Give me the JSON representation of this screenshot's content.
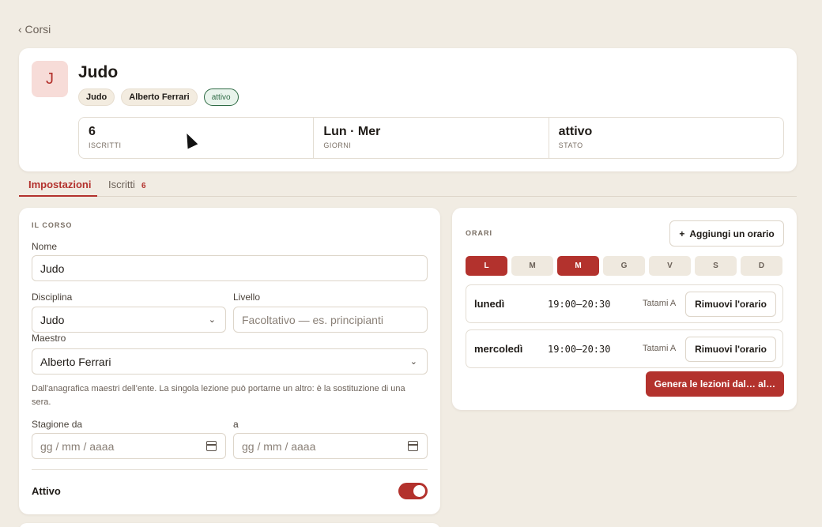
{
  "nav": {
    "back_label": "‹ Corsi"
  },
  "course": {
    "initial": "J",
    "title": "Judo",
    "chips": [
      "Judo",
      "Alberto Ferrari",
      "attivo"
    ],
    "stats": [
      {
        "value": "6",
        "label": "ISCRITTI"
      },
      {
        "value": "Lun · Mer",
        "label": "GIORNI"
      },
      {
        "value": "attivo",
        "label": "STATO"
      }
    ]
  },
  "tabs": [
    {
      "label": "Impostazioni",
      "active": true
    },
    {
      "label": "Iscritti",
      "count": "6"
    }
  ],
  "form": {
    "section": "IL CORSO",
    "name_label": "Nome",
    "name_value": "Judo",
    "discipline_label": "Disciplina",
    "discipline_value": "Judo",
    "level_label": "Livello",
    "level_placeholder": "Facoltativo — es. principianti",
    "teacher_label": "Maestro",
    "teacher_value": "Alberto Ferrari",
    "help_text": "Dall'anagrafica maestri dell'ente. La singola lezione può portarne un altro: è la sostituzione di una sera.",
    "season_from_label": "Stagione da",
    "season_to_label": "a",
    "date_placeholder": "gg / mm / aaaa",
    "active_label": "Attivo",
    "active_on": true
  },
  "schedule": {
    "section": "ORARI",
    "add_label": "Aggiungi un orario",
    "days": [
      {
        "label": "L",
        "on": true
      },
      {
        "label": "M",
        "on": false
      },
      {
        "label": "M",
        "on": true
      },
      {
        "label": "G",
        "on": false
      },
      {
        "label": "V",
        "on": false
      },
      {
        "label": "S",
        "on": false
      },
      {
        "label": "D",
        "on": false
      }
    ],
    "slots": [
      {
        "day": "lunedì",
        "time": "19:00–20:30",
        "room": "Tatami A",
        "remove_label": "Rimuovi l'orario"
      },
      {
        "day": "mercoledì",
        "time": "19:00–20:30",
        "room": "Tatami A",
        "remove_label": "Rimuovi l'orario"
      }
    ],
    "generate_label": "Genera le lezioni dal… al…"
  },
  "colors": {
    "accent": "#b3322d",
    "background": "#f1ece3"
  }
}
